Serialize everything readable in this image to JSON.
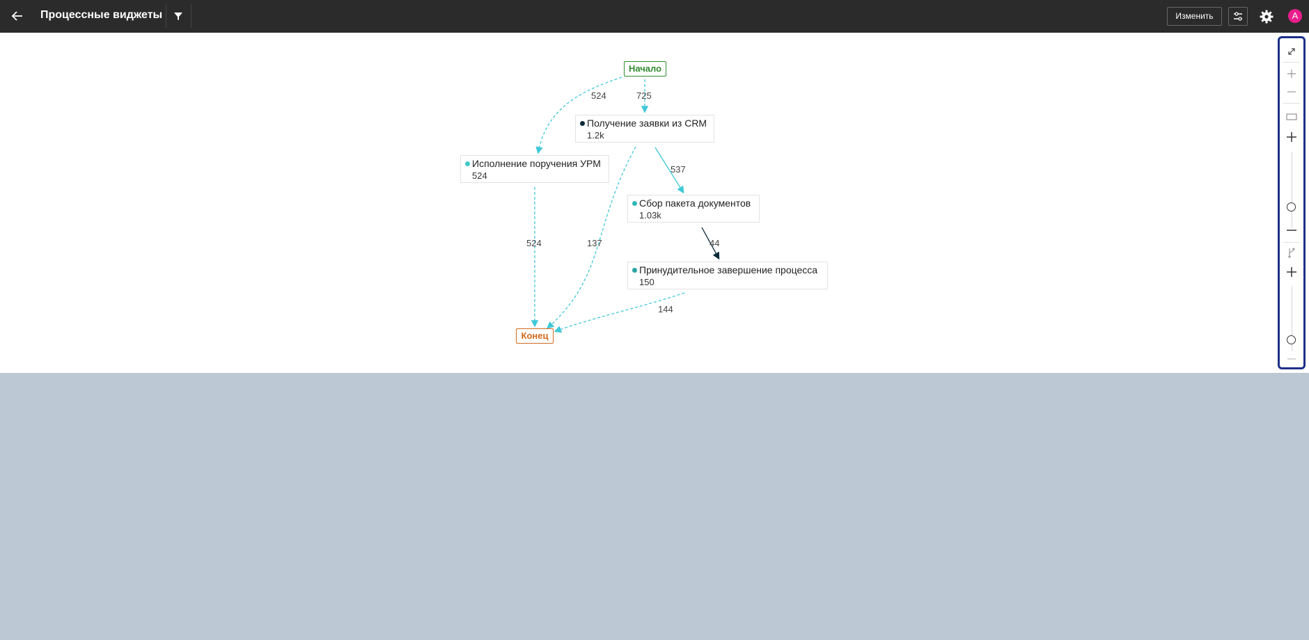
{
  "header": {
    "title": "Процессные виджеты",
    "edit_label": "Изменить",
    "avatar_letter": "A",
    "icons": [
      "arrow-left-icon",
      "funnel-icon",
      "sliders-icon",
      "gear-icon"
    ]
  },
  "graph": {
    "start_label": "Начало",
    "end_label": "Конец",
    "nodes": [
      {
        "name": "Получение заявки из CRM",
        "count": "1.2k",
        "dot_color": "#0b2a3a"
      },
      {
        "name": "Исполнение поручения УРМ",
        "count": "524",
        "dot_color": "#3fc8c8"
      },
      {
        "name": "Сбор пакета документов",
        "count": "1.03k",
        "dot_color": "#33b8b8"
      },
      {
        "name": "Принудительное завершение процесса",
        "count": "150",
        "dot_color": "#2aa3a3"
      }
    ],
    "edges": [
      {
        "from": "Начало",
        "to": "Исполнение поручения УРМ",
        "label": "524"
      },
      {
        "from": "Начало",
        "to": "Получение заявки из CRM",
        "label": "725"
      },
      {
        "from": "Получение заявки из CRM",
        "to": "Сбор пакета документов",
        "label": "537"
      },
      {
        "from": "Исполнение поручения УРМ",
        "to": "Конец",
        "label": "524"
      },
      {
        "from": "Получение заявки из CRM",
        "to": "Конец",
        "label": "137"
      },
      {
        "from": "Сбор пакета документов",
        "to": "Принудительное завершение процесса",
        "label": "44"
      },
      {
        "from": "Принудительное завершение процесса",
        "to": "Конец",
        "label": "144"
      }
    ],
    "colors": {
      "edge": "#3fc8d8",
      "edge_dark": "#0b2a3a",
      "start": "#2e8b2e",
      "end": "#d2691e"
    }
  },
  "zoom_panel": {
    "icons": [
      "expand-icon",
      "plus-icon",
      "minus-icon",
      "rectangle-icon",
      "plus-icon",
      "minus-icon",
      "branch-icon",
      "plus-icon",
      "minus-icon"
    ],
    "slider_activity_level": 0.3,
    "slider_paths_level": 0.1
  }
}
